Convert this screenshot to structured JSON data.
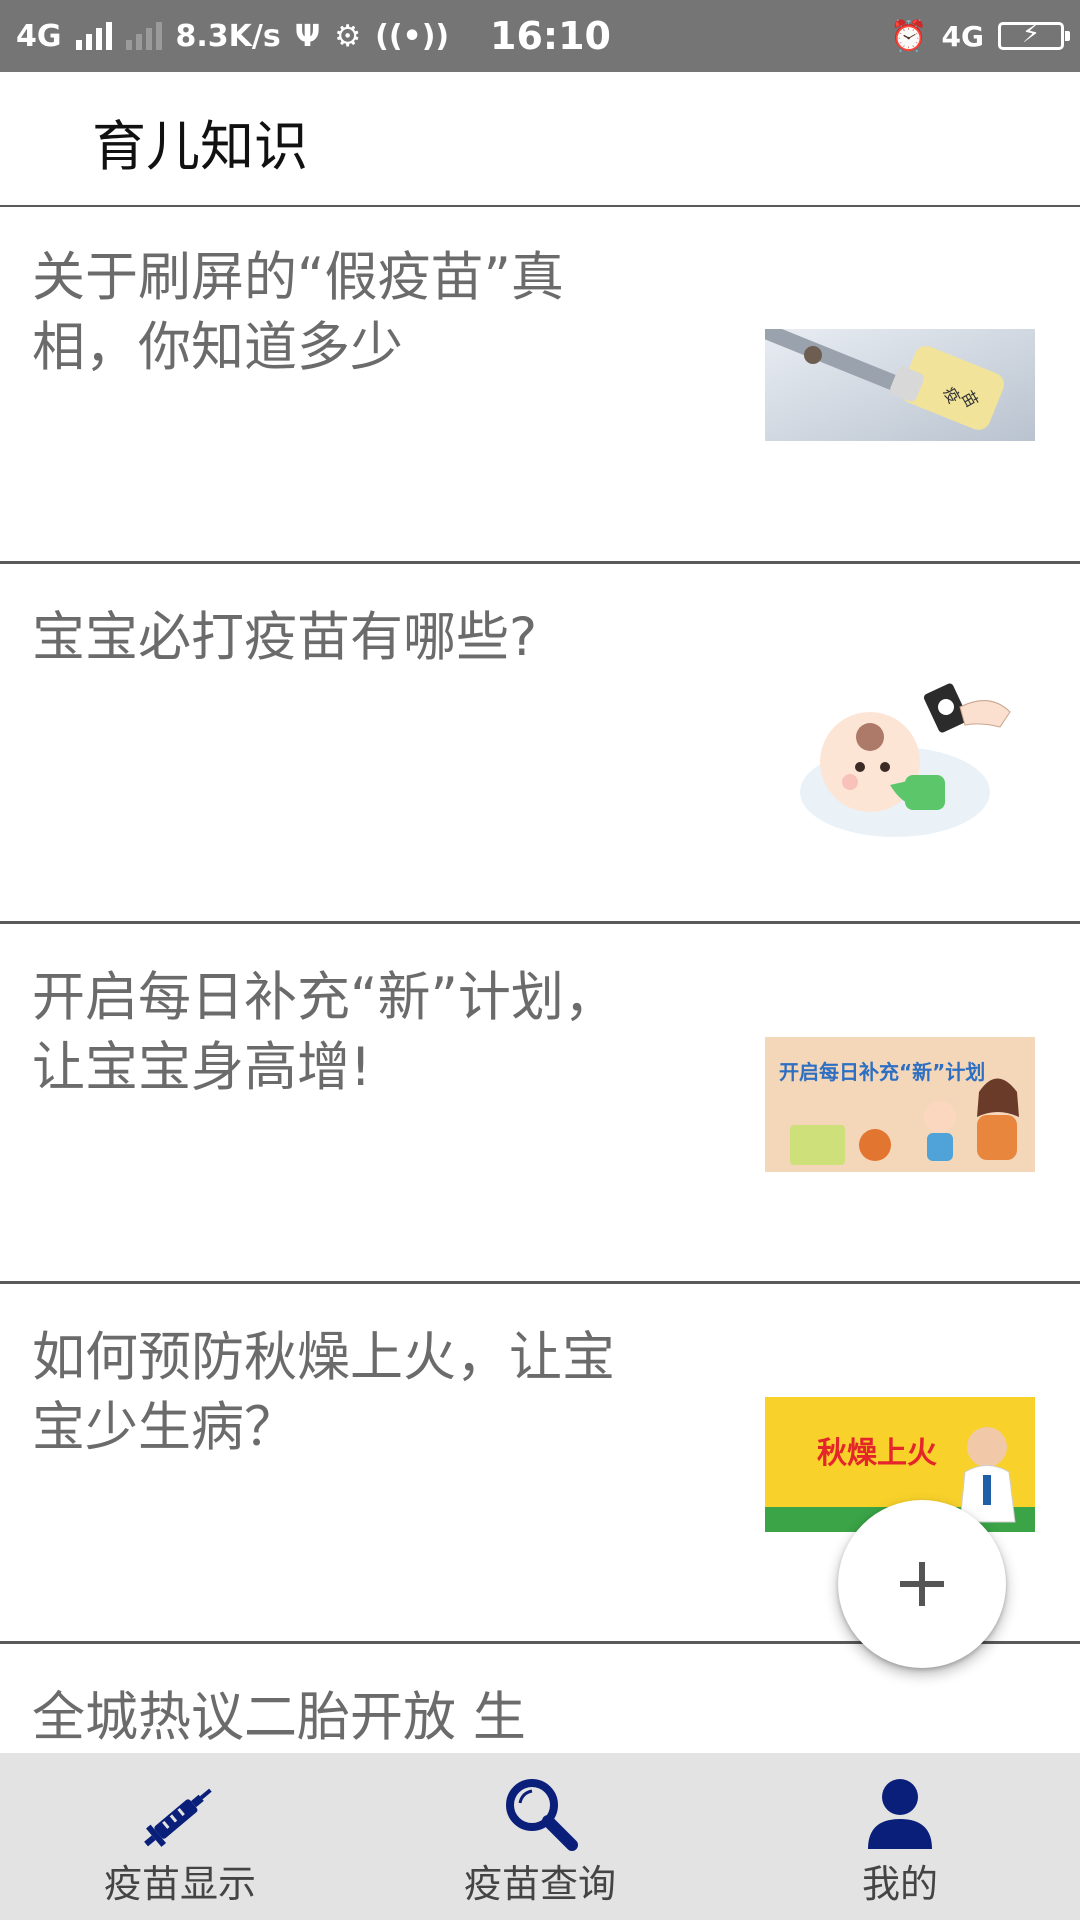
{
  "status_bar": {
    "network_left": "4G",
    "speed": "8.3K/s",
    "time": "16:10",
    "network_right": "4G"
  },
  "header": {
    "title": "育儿知识"
  },
  "articles": [
    {
      "title": "关于刷屏的“假疫苗”真相，你知道多少",
      "thumb": "vaccine-vial-image"
    },
    {
      "title": "宝宝必打疫苗有哪些?",
      "thumb": "baby-cartoon-image"
    },
    {
      "title": "开启每日补充“新”计划，让宝宝身高增!",
      "thumb": "growth-plan-banner",
      "banner_text": "开启每日补充“新”计划"
    },
    {
      "title": "如何预防秋燥上火，让宝宝少生病？",
      "thumb": "autumn-dryness-banner",
      "banner_text": "秋燥上火"
    },
    {
      "title": "全城热议二胎开放 生",
      "thumb": ""
    }
  ],
  "fab": {
    "icon": "plus-icon"
  },
  "bottom_nav": {
    "items": [
      {
        "label": "疫苗显示",
        "icon": "syringe-icon"
      },
      {
        "label": "疫苗查询",
        "icon": "search-icon"
      },
      {
        "label": "我的",
        "icon": "person-icon"
      }
    ],
    "icon_color": "#0a1f7a"
  }
}
